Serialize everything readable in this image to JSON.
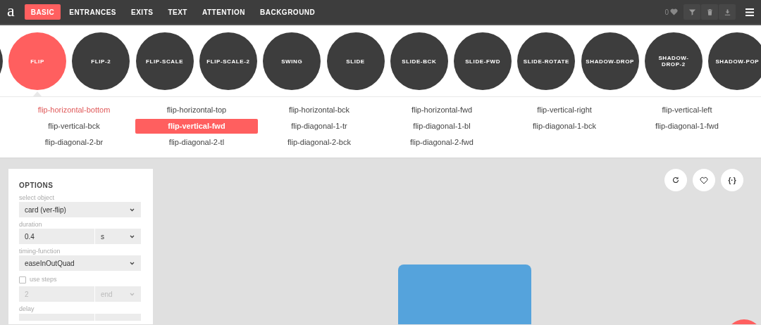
{
  "top_bar": {
    "logo": "a",
    "tabs": [
      {
        "label": "BASIC",
        "selected": true
      },
      {
        "label": "ENTRANCES",
        "selected": false
      },
      {
        "label": "EXITS",
        "selected": false
      },
      {
        "label": "TEXT",
        "selected": false
      },
      {
        "label": "ATTENTION",
        "selected": false
      },
      {
        "label": "BACKGROUND",
        "selected": false
      }
    ],
    "favorites_count": "0"
  },
  "groups": [
    {
      "label": "FLIP",
      "selected": true
    },
    {
      "label": "FLIP-2",
      "selected": false
    },
    {
      "label": "FLIP-SCALE",
      "selected": false
    },
    {
      "label": "FLIP-SCALE-2",
      "selected": false
    },
    {
      "label": "SWING",
      "selected": false
    },
    {
      "label": "SLIDE",
      "selected": false
    },
    {
      "label": "SLIDE-BCK",
      "selected": false
    },
    {
      "label": "SLIDE-FWD",
      "selected": false
    },
    {
      "label": "SLIDE-ROTATE",
      "selected": false
    },
    {
      "label": "SHADOW-DROP",
      "selected": false
    },
    {
      "label": "SHADOW-DROP-2",
      "selected": false
    },
    {
      "label": "SHADOW-POP",
      "selected": false
    }
  ],
  "animations": [
    {
      "label": "flip-horizontal-bottom",
      "selected": false,
      "hovered": true
    },
    {
      "label": "flip-horizontal-top",
      "selected": false,
      "hovered": false
    },
    {
      "label": "flip-horizontal-bck",
      "selected": false,
      "hovered": false
    },
    {
      "label": "flip-horizontal-fwd",
      "selected": false,
      "hovered": false
    },
    {
      "label": "flip-vertical-right",
      "selected": false,
      "hovered": false
    },
    {
      "label": "flip-vertical-left",
      "selected": false,
      "hovered": false
    },
    {
      "label": "flip-vertical-bck",
      "selected": false,
      "hovered": false
    },
    {
      "label": "flip-vertical-fwd",
      "selected": true,
      "hovered": false
    },
    {
      "label": "flip-diagonal-1-tr",
      "selected": false,
      "hovered": false
    },
    {
      "label": "flip-diagonal-1-bl",
      "selected": false,
      "hovered": false
    },
    {
      "label": "flip-diagonal-1-bck",
      "selected": false,
      "hovered": false
    },
    {
      "label": "flip-diagonal-1-fwd",
      "selected": false,
      "hovered": false
    },
    {
      "label": "flip-diagonal-2-br",
      "selected": false,
      "hovered": false
    },
    {
      "label": "flip-diagonal-2-tl",
      "selected": false,
      "hovered": false
    },
    {
      "label": "flip-diagonal-2-bck",
      "selected": false,
      "hovered": false
    },
    {
      "label": "flip-diagonal-2-fwd",
      "selected": false,
      "hovered": false
    }
  ],
  "options": {
    "title": "OPTIONS",
    "select_object": {
      "label": "select object",
      "value": "card (ver-flip)"
    },
    "duration": {
      "label": "duration",
      "value": "0.4",
      "unit": "s"
    },
    "timing_function": {
      "label": "timing-function",
      "value": "easeInOutQuad"
    },
    "use_steps": {
      "label": "use steps",
      "checked": false,
      "count": "2",
      "position": "end"
    },
    "delay": {
      "label": "delay"
    }
  },
  "preview": {
    "code_button": "{·}"
  }
}
